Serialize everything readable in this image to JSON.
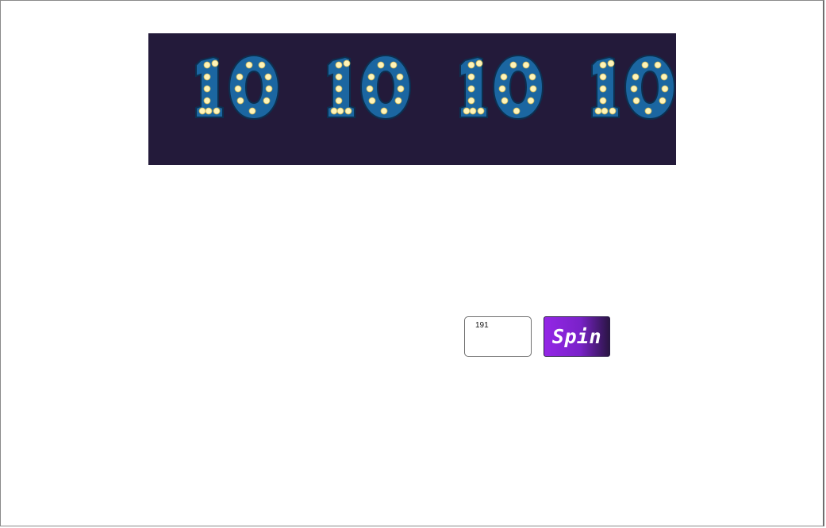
{
  "reels": {
    "background_color": "#231a3a",
    "symbols": [
      {
        "text": "10",
        "icon": "marquee-10-icon"
      },
      {
        "text": "10",
        "icon": "marquee-10-icon"
      },
      {
        "text": "10",
        "icon": "marquee-10-icon"
      },
      {
        "text": "10",
        "icon": "marquee-10-icon"
      }
    ]
  },
  "controls": {
    "bet_value": "191",
    "spin_label": "Spin",
    "spin_gradient": [
      "#9426e6",
      "#7a22c9",
      "#2a1544"
    ]
  },
  "colors": {
    "symbol_fill": "#1b66a1",
    "symbol_outline": "#0c2f50",
    "bulb": "#fff4b8"
  }
}
